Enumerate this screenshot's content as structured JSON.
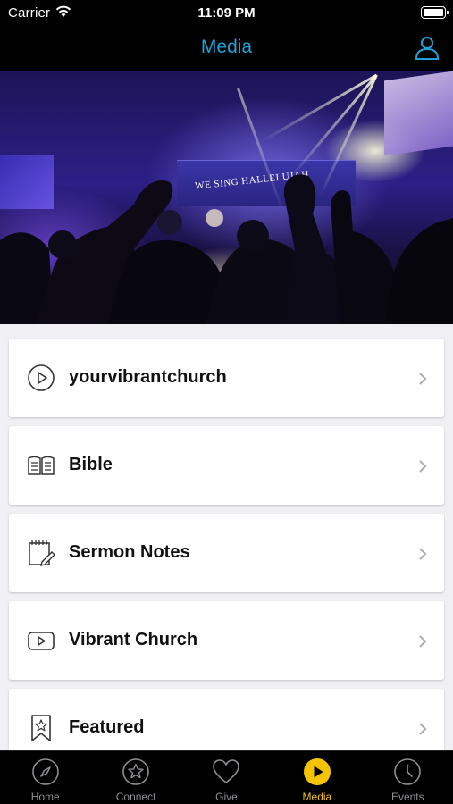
{
  "status_bar": {
    "carrier": "Carrier",
    "time": "11:09 PM"
  },
  "nav": {
    "title": "Media"
  },
  "hero": {
    "caption": "WE SING HALLELUJAH"
  },
  "list": {
    "items": [
      {
        "label": "yourvibrantchurch",
        "icon": "play-circle-icon"
      },
      {
        "label": "Bible",
        "icon": "open-book-icon"
      },
      {
        "label": "Sermon Notes",
        "icon": "notepad-pencil-icon"
      },
      {
        "label": "Vibrant Church",
        "icon": "video-play-icon"
      },
      {
        "label": "Featured",
        "icon": "bookmark-star-icon"
      }
    ]
  },
  "tabs": [
    {
      "label": "Home",
      "icon": "compass-icon",
      "active": false
    },
    {
      "label": "Connect",
      "icon": "star-circle-icon",
      "active": false
    },
    {
      "label": "Give",
      "icon": "heart-icon",
      "active": false
    },
    {
      "label": "Media",
      "icon": "play-circle-filled-icon",
      "active": true
    },
    {
      "label": "Events",
      "icon": "clock-icon",
      "active": false
    }
  ],
  "colors": {
    "accent": "#1ea3d8",
    "active_tab": "#f5c400",
    "inactive_tab": "#8e8e93"
  }
}
